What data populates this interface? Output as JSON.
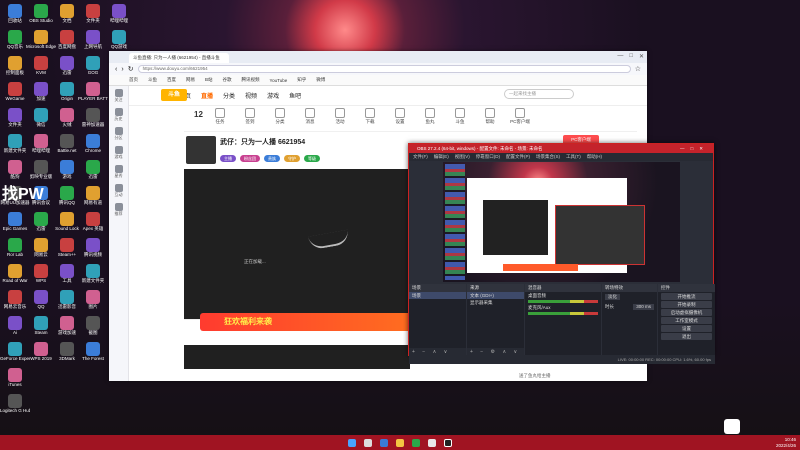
{
  "desktop": {
    "col1": [
      "回收站",
      "QQ音乐",
      "控制面板",
      "WeGame",
      "文件夹",
      "新建文件夹",
      "酷狗",
      "网易UU加速器",
      "Epic Games",
      "Ror Lab",
      "Road of War",
      "网易云音乐",
      "Ai",
      "GeForce Experience",
      "iTunes",
      "Logitech G Hub"
    ],
    "col2": [
      "OBS Studio",
      "Microsoft Edge",
      "KVM",
      "加速",
      "微信",
      "哔哩哔哩",
      "剪映专业版",
      "腾讯会议",
      "迅雷",
      "网易云",
      "WPS",
      "QQ",
      "Steam",
      "WPS 2019"
    ],
    "col3": [
      "文档",
      "百度网盘",
      "迅雷",
      "Origin",
      "火绒",
      "Battle.net",
      "游戏",
      "腾讯QQ",
      "Sound Lock",
      "Steam++",
      "工具",
      "迅雷影音",
      "游戏加速",
      "3DMark"
    ],
    "col4": [
      "文件夹",
      "上网导航",
      "GOG",
      "PLAYER BATTLEGROUNDS",
      "雷神加速器",
      "Chrome",
      "迅雷",
      "网易有道",
      "Apex 英雄",
      "腾讯视频",
      "新建文件夹",
      "图片",
      "截图",
      "The Forest"
    ],
    "col5": [
      "哔哩哔哩",
      "QQ游戏"
    ],
    "pw_text": "找PW"
  },
  "browser": {
    "tab_label": "斗鱼直播: 只为一人播 (6621954) - 直播斗鱼",
    "address": "https://www.douyu.com/6621954",
    "bookmarks": [
      "首页",
      "斗鱼",
      "百度",
      "网易",
      "B站",
      "谷歌",
      "腾讯视频",
      "YouTube",
      "知乎",
      "微博"
    ],
    "sidebar": [
      "关注",
      "历史",
      "分区",
      "游戏",
      "星秀",
      "互动",
      "推荐"
    ],
    "nav": [
      "首页",
      "直播",
      "分类",
      "视频",
      "游戏",
      "鱼吧"
    ],
    "nav_active": "直播",
    "search_placeholder": "一起来找主播",
    "level_number": "12",
    "categories": [
      "任务",
      "签到",
      "分类",
      "消息",
      "活动",
      "下载",
      "设置",
      "鱼丸",
      "斗鱼",
      "帮助",
      "PC客户端"
    ],
    "room": {
      "title": "武仔：只为一人播  6621954",
      "badges": [
        "主播",
        "粉丝团",
        "贵族",
        "守护",
        "等级"
      ],
      "pc_button": "PC客户端"
    },
    "player_status": "正在加载...",
    "promo_text": "狂欢福利来袭",
    "chat_footer": "送了鱼丸给主播"
  },
  "obs": {
    "title": "OBS 27.2.4 (64-bit, windows) - 配置文件: 未命名 - 场景: 未命名",
    "menu": [
      "文件(F)",
      "编辑(E)",
      "视图(V)",
      "停靠窗口(D)",
      "配置文件(P)",
      "场景集合(S)",
      "工具(T)",
      "帮助(H)"
    ],
    "docks": {
      "scenes_header": "场景",
      "scenes": [
        "场景"
      ],
      "sources_header": "来源",
      "sources": [
        "文本 (GDI+)",
        "显示器采集"
      ],
      "mixer_header": "混音器",
      "mixer": [
        "桌面音频",
        "麦克风/Aux"
      ],
      "transitions_header": "转场特效",
      "transition_type": "淡化",
      "duration_label": "时长",
      "duration_value": "300 ms",
      "controls_header": "控件",
      "controls": [
        "开始推流",
        "开始录制",
        "启动虚拟摄像机",
        "工作室模式",
        "设置",
        "退出"
      ]
    },
    "status": "LIVE: 00:00:00   REC: 00:00:00   CPU: 1.6%, 60.00 fps"
  },
  "taskbar": {
    "time": "10:46",
    "date": "2022/4/26"
  },
  "colors": {
    "taskbar": "#a01422",
    "obs_title": "#c4232b",
    "accent_orange": "#ff6a00",
    "promo": "#ff3b2f"
  }
}
